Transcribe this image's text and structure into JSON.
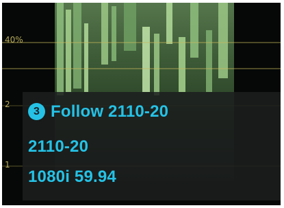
{
  "scale": {
    "label_40": "40%",
    "label_mid": "2",
    "label_low": "1",
    "accent_color": "#d4c46a"
  },
  "overlay": {
    "badge_number": "3",
    "title": "Follow 2110-20",
    "format": "2110-20",
    "resolution": "1080i 59.94",
    "accent_color": "#25c2e6"
  }
}
